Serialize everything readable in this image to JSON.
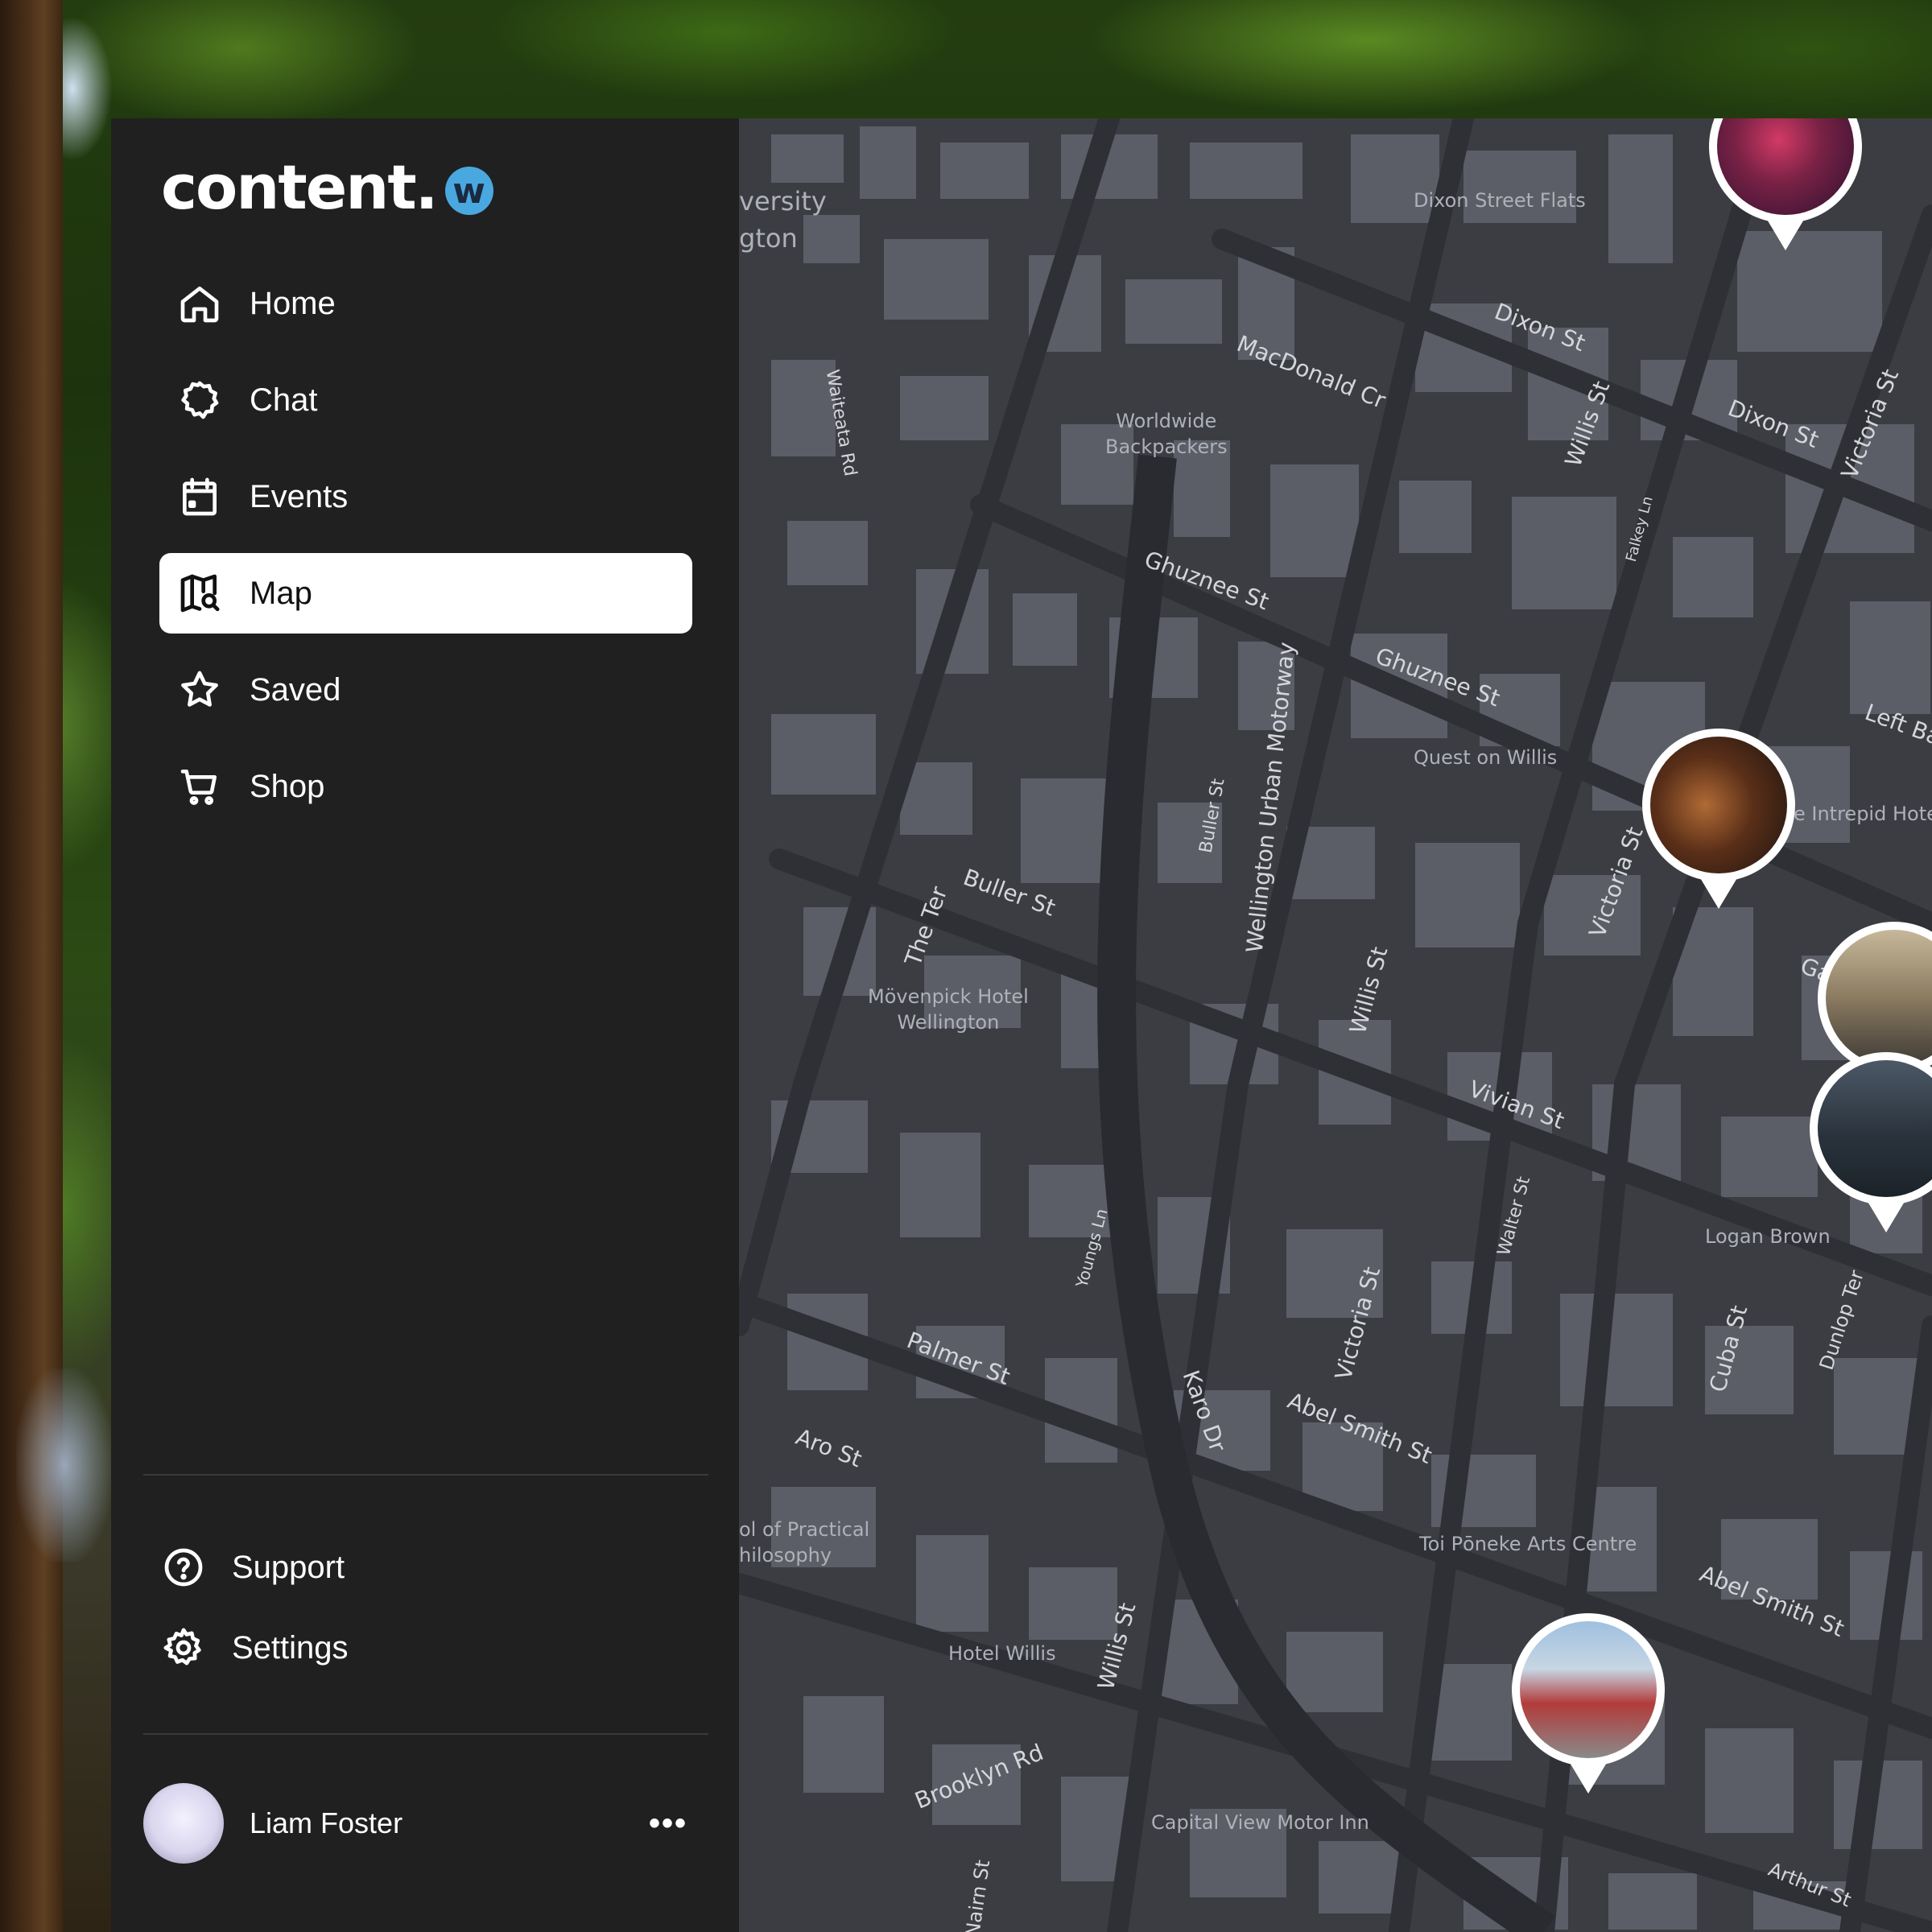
{
  "app": {
    "logo_text": "content.",
    "logo_badge": "w"
  },
  "nav": {
    "items": [
      {
        "label": "Home",
        "icon": "home-icon"
      },
      {
        "label": "Chat",
        "icon": "chat-icon"
      },
      {
        "label": "Events",
        "icon": "calendar-icon"
      },
      {
        "label": "Map",
        "icon": "map-icon",
        "active": true
      },
      {
        "label": "Saved",
        "icon": "star-icon"
      },
      {
        "label": "Shop",
        "icon": "cart-icon"
      }
    ]
  },
  "bottom_nav": {
    "support": "Support",
    "settings": "Settings"
  },
  "user": {
    "name": "Liam Foster",
    "more": "•••"
  },
  "colors": {
    "sidebar_bg": "#202020",
    "active_bg": "#ffffff",
    "map_bg": "#3f4147",
    "logo_badge": "#4aa8e0"
  },
  "map": {
    "place_labels": {
      "university": "versity\ngton",
      "dixon_street_flats": "Dixon Street Flats",
      "worldwide_backpackers": "Worldwide\nBackpackers",
      "quest_on_willis": "Quest on Willis",
      "intrepid_hotel": "e Intrepid Hote",
      "movenpick": "Mövenpick Hotel\nWellington",
      "logan_brown": "Logan Brown",
      "practical_philosophy": "ol of Practical\nhilosophy",
      "toi_poneke": "Toi Pōneke Arts Centre",
      "hotel_willis": "Hotel Willis",
      "capital_view": "Capital View Motor Inn"
    },
    "road_labels": {
      "dixon_st_1": "Dixon St",
      "dixon_st_2": "Dixon St",
      "macdonald_cr": "MacDonald Cr",
      "willis_st_1": "Willis St",
      "victoria_st_1": "Victoria St",
      "waiteata_rd": "Waiteata Rd",
      "ghuznee_st_1": "Ghuznee St",
      "ghuznee_st_2": "Ghuznee St",
      "motorway": "Wellington Urban Motorway",
      "buller_st_1": "Buller St",
      "buller_st_2": "Buller St",
      "the_ter": "The Ter",
      "willis_st_2": "Willis St",
      "victoria_st_2": "Victoria St",
      "left_bank": "Left Ba",
      "garrett": "Garrett",
      "vivian_st": "Vivian St",
      "walter_st": "Walter St",
      "youngs_ln": "Youngs Ln",
      "palmer_st": "Palmer St",
      "aro_st": "Aro St",
      "karo_dr": "Karo Dr",
      "victoria_st_3": "Victoria St",
      "abel_smith_1": "Abel Smith St",
      "abel_smith_2": "Abel Smith St",
      "cuba_st": "Cuba St",
      "dunlop_ter": "Dunlop Ter",
      "willis_st_3": "Willis St",
      "brooklyn_rd": "Brooklyn Rd",
      "nairn_st": "Nairn St",
      "arthur_st": "Arthur St",
      "falkey_ln": "Falkey Ln"
    },
    "pins": [
      {
        "name": "venue-pin-concert"
      },
      {
        "name": "venue-pin-musicians"
      },
      {
        "name": "venue-pin-san-fran"
      },
      {
        "name": "venue-pin-valhalla"
      },
      {
        "name": "venue-pin-building"
      }
    ]
  }
}
